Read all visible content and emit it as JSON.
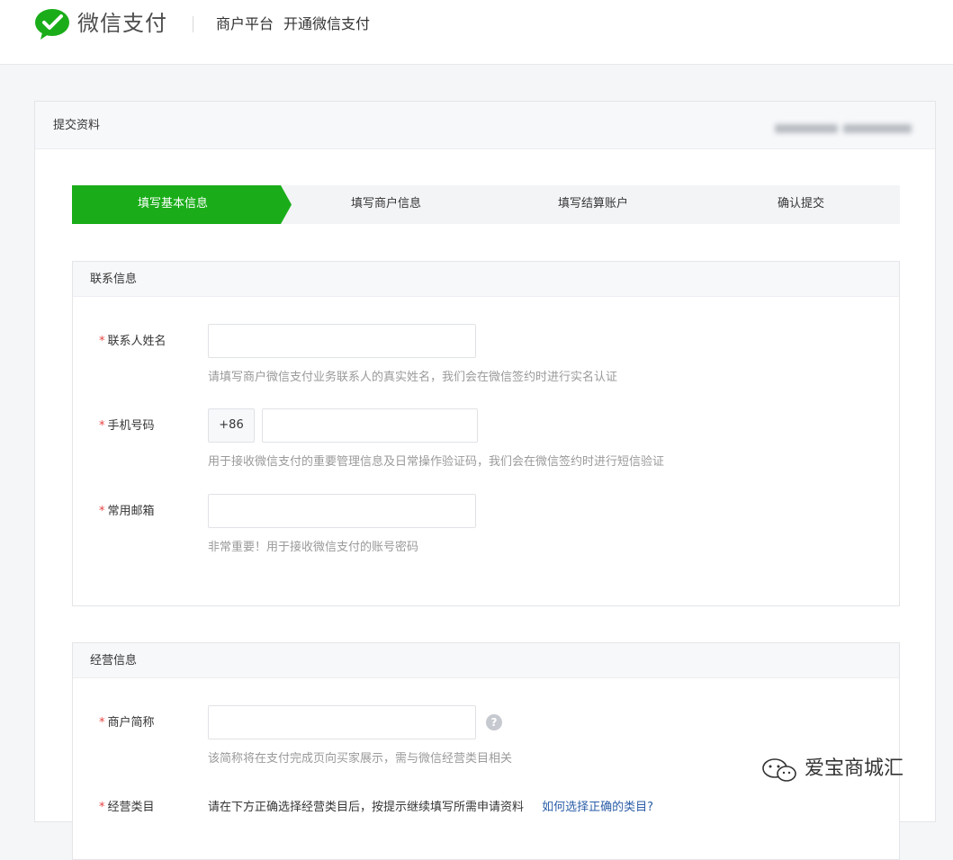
{
  "header": {
    "logo_text": "微信支付",
    "nav_platform": "商户平台",
    "nav_open": "开通微信支付",
    "brand_color": "#1aad19"
  },
  "card": {
    "title": "提交资料"
  },
  "steps": [
    {
      "label": "填写基本信息",
      "active": true
    },
    {
      "label": "填写商户信息",
      "active": false
    },
    {
      "label": "填写结算账户",
      "active": false
    },
    {
      "label": "确认提交",
      "active": false
    }
  ],
  "contact_section": {
    "title": "联系信息",
    "required_mark": "*",
    "name": {
      "label": "联系人姓名",
      "value": "",
      "hint": "请填写商户微信支付业务联系人的真实姓名，我们会在微信签约时进行实名认证"
    },
    "phone": {
      "label": "手机号码",
      "prefix": "+86",
      "value": "",
      "hint": "用于接收微信支付的重要管理信息及日常操作验证码，我们会在微信签约时进行短信验证"
    },
    "email": {
      "label": "常用邮箱",
      "value": "",
      "hint": "非常重要！用于接收微信支付的账号密码"
    }
  },
  "business_section": {
    "title": "经营信息",
    "short_name": {
      "label": "商户简称",
      "value": "",
      "help": "?",
      "hint": "该简称将在支付完成页向买家展示，需与微信经营类目相关"
    },
    "category": {
      "label": "经营类目",
      "hint": "请在下方正确选择经营类目后，按提示继续填写所需申请资料",
      "link": "如何选择正确的类目?"
    }
  },
  "watermark": {
    "text": "爱宝商城汇"
  }
}
